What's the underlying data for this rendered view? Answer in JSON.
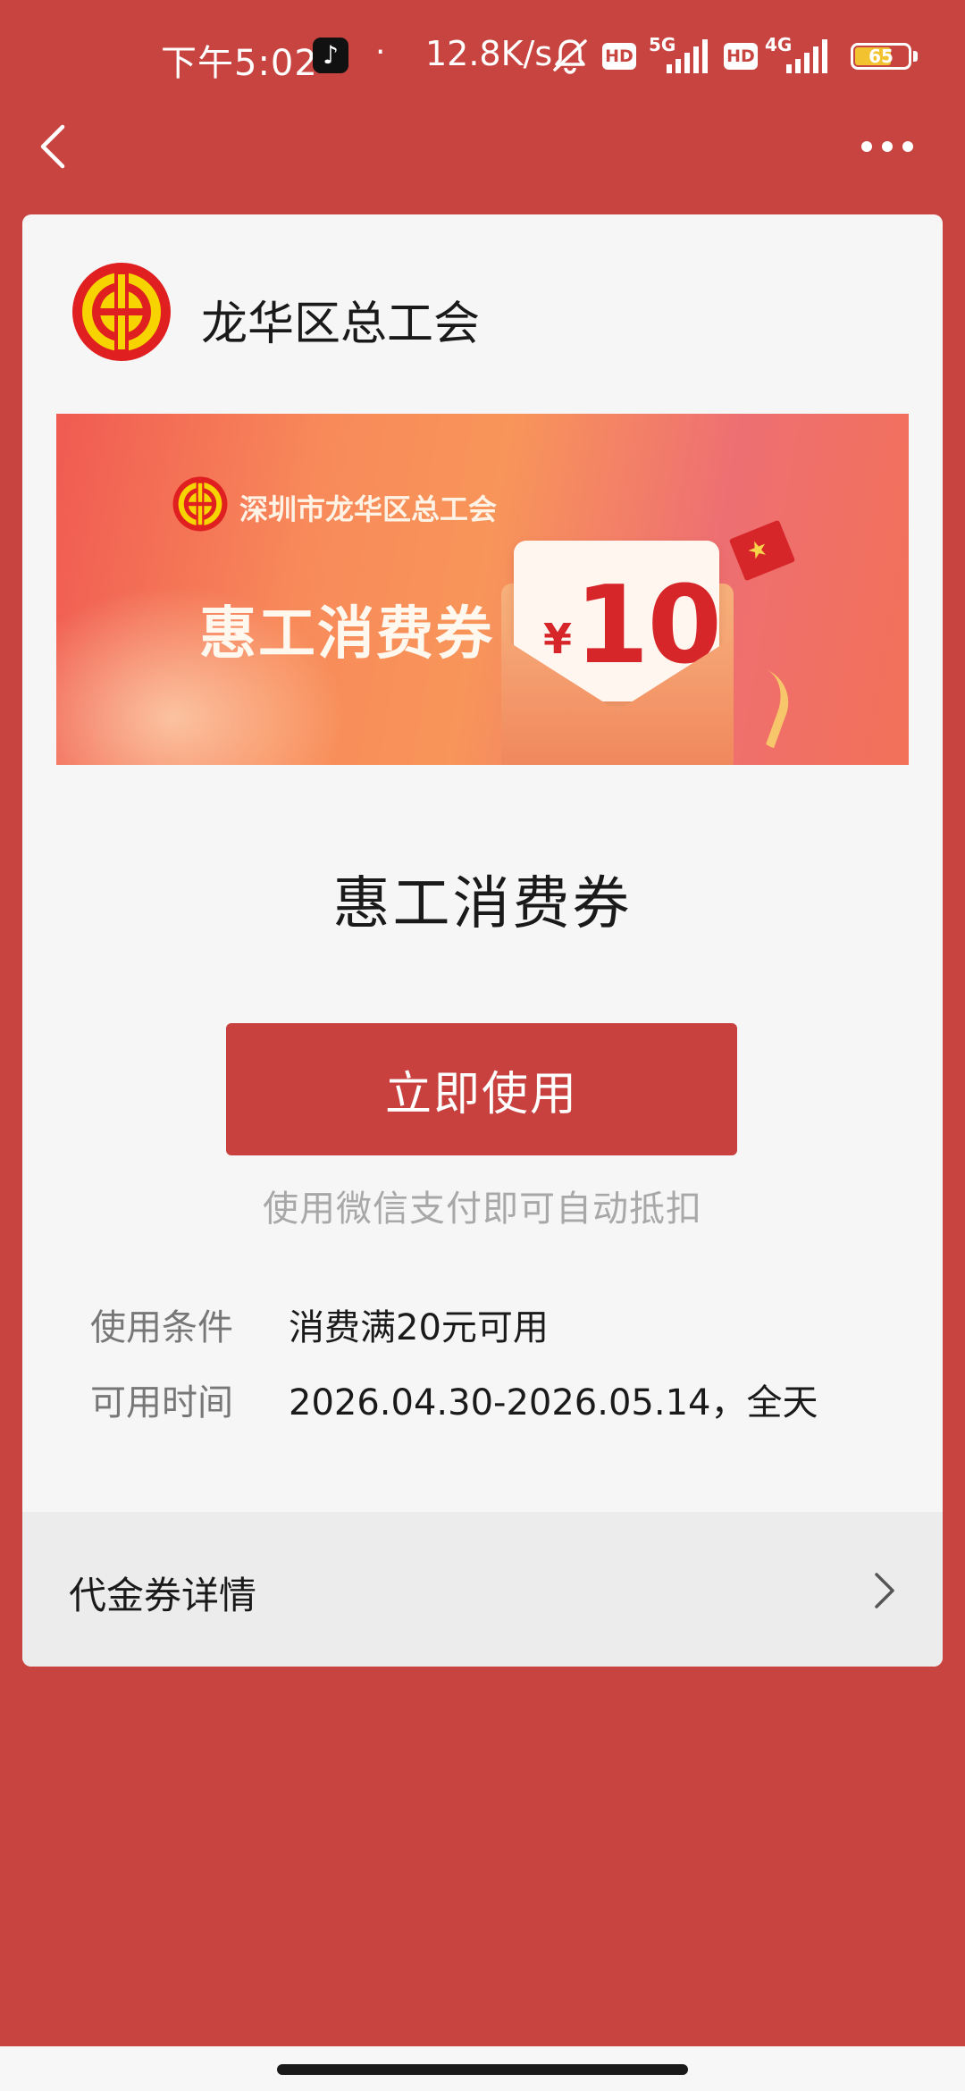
{
  "status_bar": {
    "time": "下午5:02",
    "dot": "·",
    "net_speed": "12.8K/s",
    "hd_label": "HD",
    "sim1_network": "5G",
    "sim2_network": "4G",
    "battery_level": "65"
  },
  "card": {
    "org_name": "龙华区总工会",
    "banner": {
      "org": "深圳市龙华区总工会",
      "title": "惠工消费券",
      "currency": "¥",
      "amount": "10"
    },
    "coupon_title": "惠工消费券",
    "use_button": "立即使用",
    "hint": "使用微信支付即可自动抵扣",
    "conditions": {
      "label": "使用条件",
      "value": "消费满20元可用"
    },
    "valid_time": {
      "label": "可用时间",
      "value": "2026.04.30-2026.05.14，全天"
    },
    "details_label": "代金券详情"
  },
  "colors": {
    "background": "#c84440",
    "button": "#c8413e",
    "amount": "#d7262a"
  }
}
